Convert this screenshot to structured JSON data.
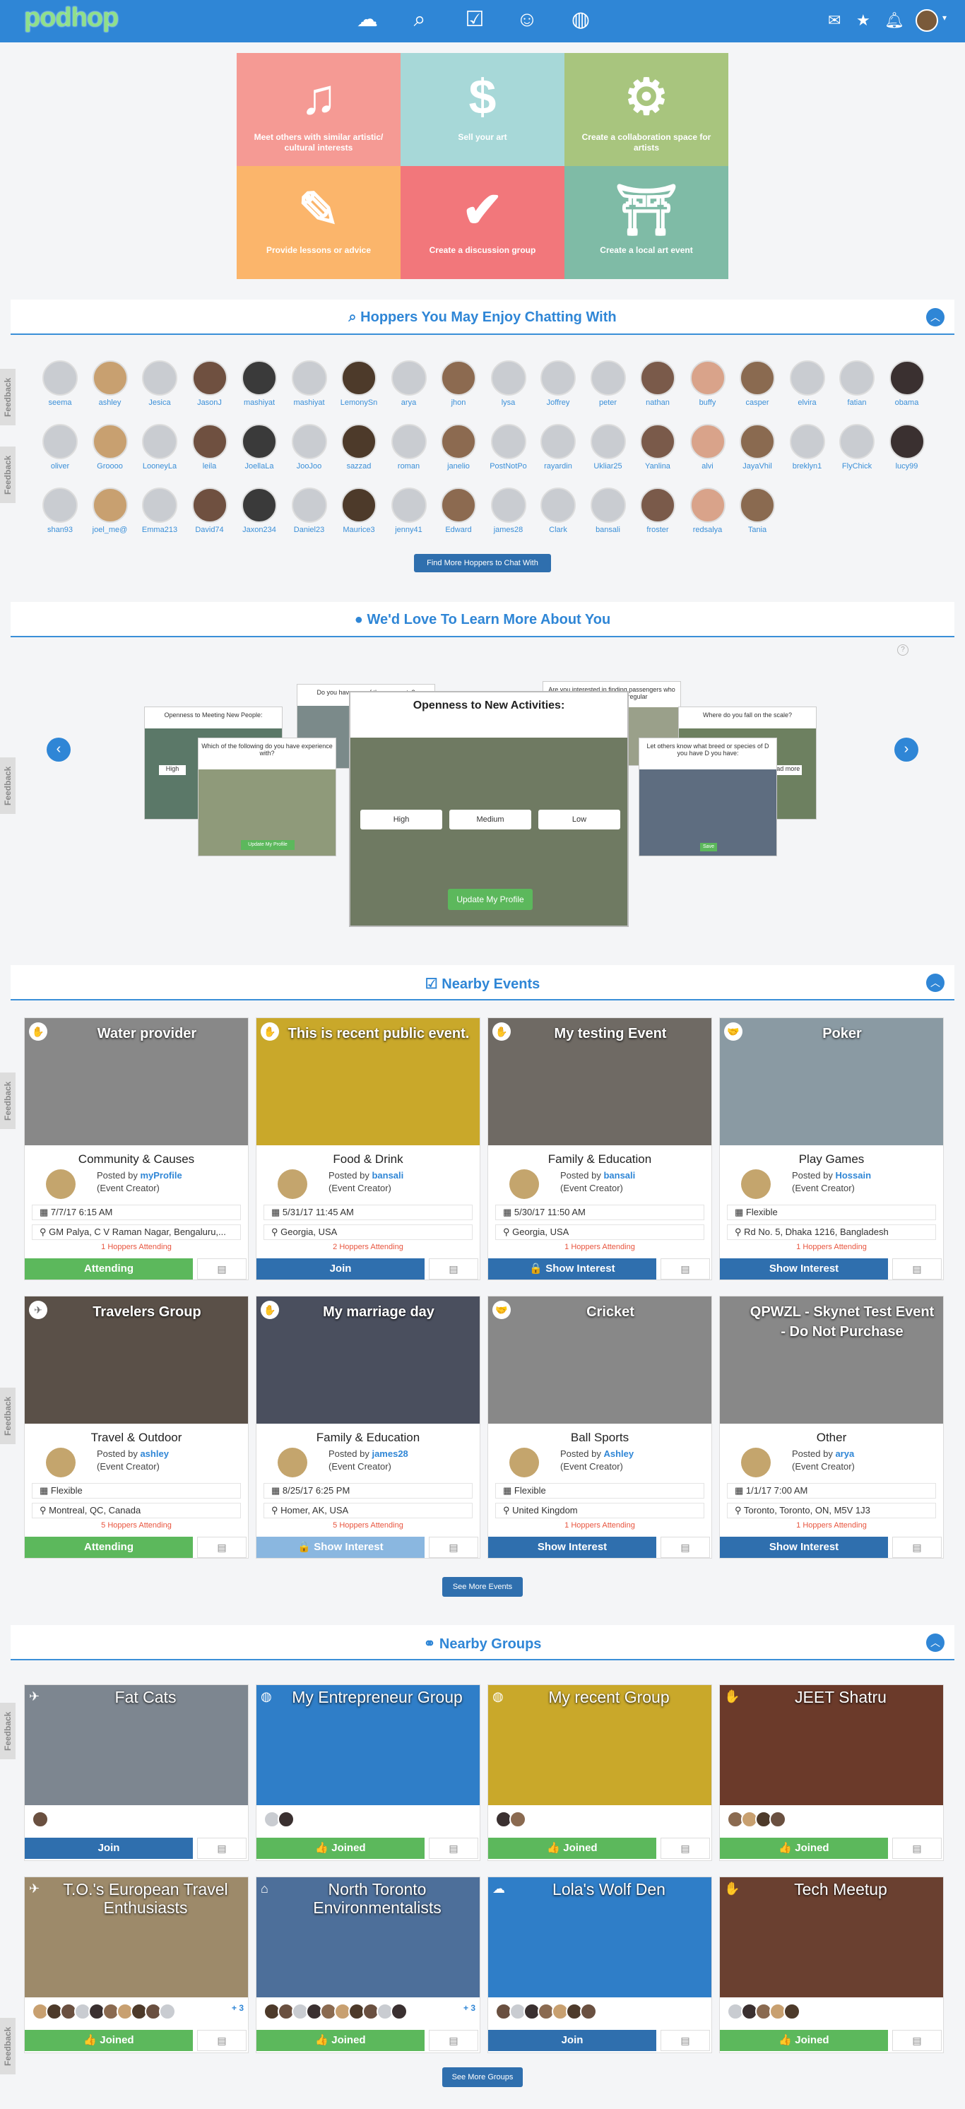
{
  "header": {
    "logo": "podhop",
    "nav_icons": [
      "cloud-icon",
      "search-people-icon",
      "calendar-check-icon",
      "groups-icon",
      "globe-icon"
    ],
    "right_icons": [
      "mail-icon",
      "star-icon",
      "bell-icon"
    ],
    "caret": "▾"
  },
  "tiles": [
    {
      "label": "Meet others with similar artistic/ cultural interests",
      "color": "#f59a94",
      "icon": "♫"
    },
    {
      "label": "Sell your art",
      "color": "#a7d8d8",
      "icon": "$"
    },
    {
      "label": "Create a collaboration space for artists",
      "color": "#a8c57e",
      "icon": "⚙"
    },
    {
      "label": "Provide lessons or advice",
      "color": "#fbb56b",
      "icon": "✎"
    },
    {
      "label": "Create a discussion group",
      "color": "#f2777b",
      "icon": "✔"
    },
    {
      "label": "Create a local art event",
      "color": "#7fbba6",
      "icon": "⛩"
    }
  ],
  "hoppers": {
    "title": "Hoppers You May Enjoy Chatting With",
    "names": [
      "seema",
      "ashley",
      "Jesica",
      "JasonJ",
      "mashiyat",
      "mashiyat",
      "LemonySn",
      "arya",
      "jhon",
      "lysa",
      "Joffrey",
      "peter",
      "nathan",
      "buffy",
      "casper",
      "elvira",
      "fatian",
      "obama",
      "oliver",
      "Groooo",
      "LooneyLa",
      "leila",
      "JoellaLa",
      "JooJoo",
      "sazzad",
      "roman",
      "janelio",
      "PostNotPo",
      "rayardin",
      "Ukliar25",
      "Yanlina",
      "alvi",
      "JayaVhil",
      "breklyn1",
      "FlyChick",
      "lucy99",
      "shan93",
      "joel_me@",
      "Emma213",
      "David74",
      "Jaxon234",
      "Daniel23",
      "Maurice3",
      "jenny41",
      "Edward",
      "james28",
      "Clark",
      "bansali",
      "froster",
      "redsalya",
      "Tania"
    ],
    "more_button": "Find More Hoppers to Chat With"
  },
  "learn": {
    "title": "We'd Love To Learn More About You",
    "help": "?",
    "main_card": {
      "title": "Openness to New Activities:",
      "options": [
        "High",
        "Medium",
        "Low"
      ],
      "button": "Update My Profile"
    },
    "side_cards": [
      "Openness to Meeting New People:",
      "Which of the following do you have experience with?",
      "Do you have any of these ex-pets?",
      "Are you interested in finding passengers who share part of your regular",
      "Let others know what breed or species of D you have D you have:",
      "Where do you fall on the scale?"
    ],
    "side_buttons": [
      "High",
      "Update My Profile",
      "Save",
      "Read more"
    ]
  },
  "events": {
    "title": "Nearby Events",
    "more_button": "See More Events",
    "posted_by_label": "Posted by",
    "creator_label": "(Event Creator)",
    "items": [
      {
        "title": "Water provider",
        "category": "Community & Causes",
        "poster": "myProfile",
        "date": "7/7/17 6:15 AM",
        "location": "GM Palya, C V Raman Nagar, Bengaluru,...",
        "attending": "1 Hoppers Attending",
        "button": "Attending",
        "btn_style": "gr",
        "img": "#888888"
      },
      {
        "title": "This is recent public event.",
        "category": "Food & Drink",
        "poster": "bansali",
        "date": "5/31/17 11:45 AM",
        "location": "Georgia, USA",
        "attending": "2 Hoppers Attending",
        "button": "Join",
        "btn_style": "bl",
        "img": "#c9a82a"
      },
      {
        "title": "My testing Event",
        "category": "Family & Education",
        "poster": "bansali",
        "date": "5/30/17 11:50 AM",
        "location": "Georgia, USA",
        "attending": "1 Hoppers Attending",
        "button": "🔒 Show Interest",
        "btn_style": "bl",
        "img": "#6f6a64"
      },
      {
        "title": "Poker",
        "category": "Play Games",
        "poster": "Hossain",
        "date": "Flexible",
        "location": "Rd No. 5, Dhaka 1216, Bangladesh",
        "attending": "1 Hoppers Attending",
        "button": "Show Interest",
        "btn_style": "bl",
        "img": "#8a9aa3"
      },
      {
        "title": "Travelers Group",
        "category": "Travel & Outdoor",
        "poster": "ashley",
        "date": "Flexible",
        "location": "Montreal, QC, Canada",
        "attending": "5 Hoppers Attending",
        "button": "Attending",
        "btn_style": "gr",
        "img": "#5a5048"
      },
      {
        "title": "My marriage day",
        "category": "Family & Education",
        "poster": "james28",
        "date": "8/25/17 6:25 PM",
        "location": "Homer, AK, USA",
        "attending": "5 Hoppers Attending",
        "button": "🔒 Show Interest",
        "btn_style": "lb",
        "img": "#4a4f5e"
      },
      {
        "title": "Cricket",
        "category": "Ball Sports",
        "poster": "Ashley",
        "date": "Flexible",
        "location": "United Kingdom",
        "attending": "1 Hoppers Attending",
        "button": "Show Interest",
        "btn_style": "bl",
        "img": "#888888"
      },
      {
        "title": "QPWZL - Skynet Test Event - Do Not Purchase",
        "category": "Other",
        "poster": "arya",
        "date": "1/1/17 7:00 AM",
        "location": "Toronto, Toronto, ON, M5V 1J3",
        "attending": "1 Hoppers Attending",
        "button": "Show Interest",
        "btn_style": "bl",
        "img": "#888888"
      }
    ]
  },
  "groups": {
    "title": "Nearby Groups",
    "more_button": "See More Groups",
    "items": [
      {
        "title": "Fat Cats",
        "members": 1,
        "more": "",
        "button": "Join",
        "btn_style": "bl",
        "img": "#7d8690"
      },
      {
        "title": "My Entrepreneur Group",
        "members": 2,
        "more": "",
        "button": "👍 Joined",
        "btn_style": "gr",
        "img": "#2f7ec8"
      },
      {
        "title": "My recent Group",
        "members": 2,
        "more": "",
        "button": "👍 Joined",
        "btn_style": "gr",
        "img": "#c9a82a"
      },
      {
        "title": "JEET Shatru",
        "members": 4,
        "more": "",
        "button": "👍 Joined",
        "btn_style": "gr",
        "img": "#6b3a2a"
      },
      {
        "title": "T.O.'s European Travel Enthusiasts",
        "members": 10,
        "more": "+ 3",
        "button": "👍 Joined",
        "btn_style": "gr",
        "img": "#9d8a6a"
      },
      {
        "title": "North Toronto Environmentalists",
        "members": 10,
        "more": "+ 3",
        "button": "👍 Joined",
        "btn_style": "gr",
        "img": "#4d6f9a"
      },
      {
        "title": "Lola's Wolf Den",
        "members": 7,
        "more": "",
        "button": "Join",
        "btn_style": "bl",
        "img": "#2f7ec8"
      },
      {
        "title": "Tech Meetup",
        "members": 5,
        "more": "",
        "button": "👍 Joined",
        "btn_style": "gr",
        "img": "#6a4030"
      }
    ]
  },
  "feedback_label": "Feedback"
}
